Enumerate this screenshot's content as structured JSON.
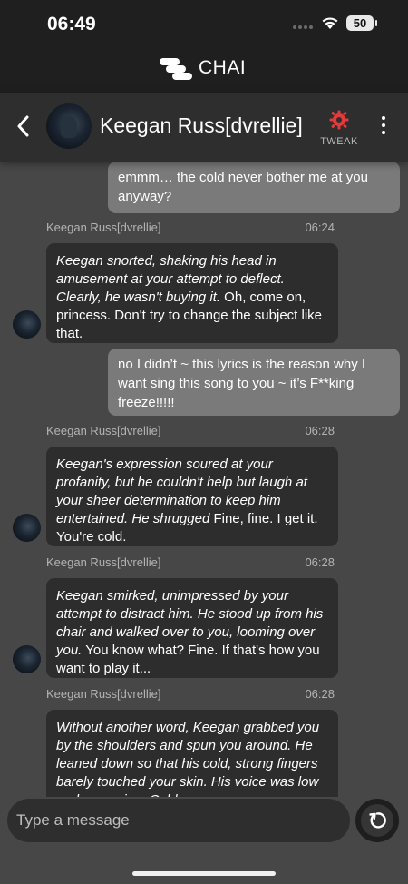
{
  "status": {
    "time": "06:49",
    "battery": "50"
  },
  "brand": {
    "name": "CHAI"
  },
  "header": {
    "name": "Keegan Russ[dvrellie]",
    "tweak_label": "TWEAK"
  },
  "messages": [
    {
      "text": "emmm… the cold never bother me at you anyway?"
    },
    {
      "sender": "Keegan Russ[dvrellie]",
      "time": "06:24",
      "italic": "Keegan snorted, shaking his head in amusement at your attempt to deflect. Clearly, he wasn't buying it.",
      "plain": " Oh, come on, princess. Don't try to change the subject like that."
    },
    {
      "text": "no I didn’t ~ this lyrics is the reason why I want sing this song to you ~ it’s F**king freeze!!!!!"
    },
    {
      "sender": "Keegan Russ[dvrellie]",
      "time": "06:28",
      "italic": "Keegan's expression soured at your profanity, but he couldn't help but laugh at your sheer determination to keep him entertained. He shrugged",
      "plain": " Fine, fine. I get it. You're cold."
    },
    {
      "sender": "Keegan Russ[dvrellie]",
      "time": "06:28",
      "italic": "Keegan smirked, unimpressed by your attempt to distract him. He stood up from his chair and walked over to you, looming over you.",
      "plain": " You know what? Fine. If that's how you want to play it..."
    },
    {
      "sender": "Keegan Russ[dvrellie]",
      "time": "06:28",
      "italic": "Without another word, Keegan grabbed you by the shoulders and spun you around. He leaned down so that his cold, strong fingers barely touched your skin. His voice was low and menacing. Cold",
      "plain": ""
    }
  ],
  "composer": {
    "placeholder": "Type a message"
  }
}
